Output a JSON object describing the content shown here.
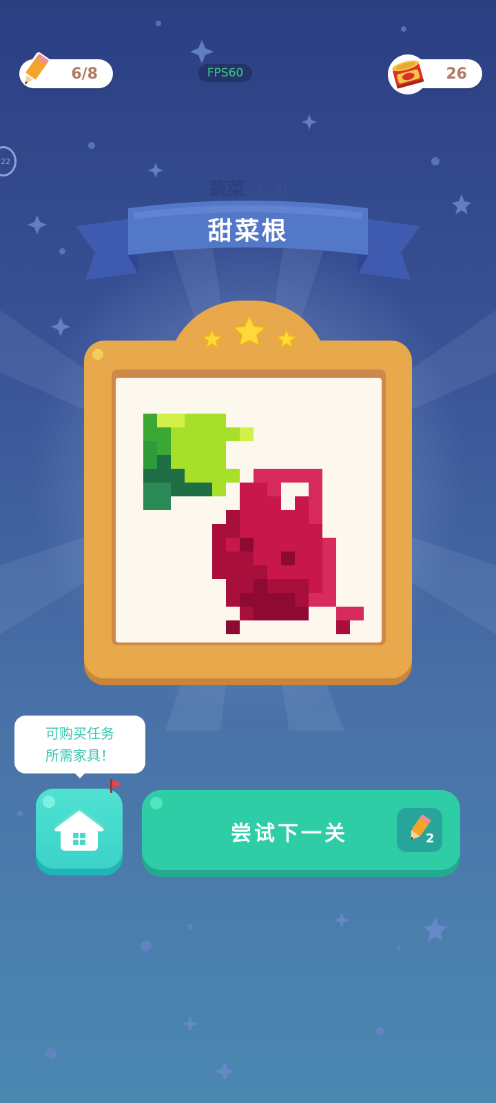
{
  "hud": {
    "pencils": "6/8",
    "coins": "26",
    "fps": "FPS60",
    "side_timer": "22"
  },
  "level": {
    "category": "蔬菜",
    "category_progress": "(3 / 8)",
    "title": "甜菜根",
    "stars_earned": 3,
    "stars_total": 3
  },
  "tooltip": {
    "line1": "可购买任务",
    "line2": "所需家具！"
  },
  "buttons": {
    "next_label": "尝试下一关",
    "next_cost": "2"
  },
  "colors": {
    "accent_teal": "#2ecda6",
    "frame_orange": "#e8a84c",
    "ribbon_blue": "#5478c8",
    "star_yellow": "#ffd83a"
  }
}
